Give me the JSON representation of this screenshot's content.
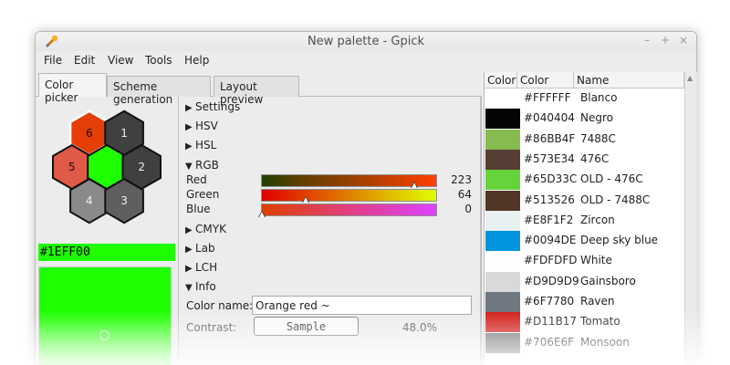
{
  "window": {
    "title": "New palette - Gpick",
    "controls": [
      "–",
      "+",
      "×"
    ]
  },
  "menu": [
    "File",
    "Edit",
    "View",
    "Tools",
    "Help"
  ],
  "tabs": [
    "Color picker",
    "Scheme generation",
    "Layout preview"
  ],
  "hexagons": [
    {
      "label": "6",
      "color": "#e53e07"
    },
    {
      "label": "1",
      "color": "#404040"
    },
    {
      "label": "5",
      "color": "#e05a47"
    },
    {
      "label": "",
      "color": "#1eff00"
    },
    {
      "label": "2",
      "color": "#404040"
    },
    {
      "label": "4",
      "color": "#8a8a8a"
    },
    {
      "label": "3",
      "color": "#5f5f5f"
    }
  ],
  "current_hex": "#1EFF00",
  "expanders": {
    "settings": "Settings",
    "hsv": "HSV",
    "hsl": "HSL",
    "rgb": "RGB",
    "cmyk": "CMYK",
    "lab": "Lab",
    "lch": "LCH",
    "info": "Info"
  },
  "rgb": {
    "red": {
      "label": "Red",
      "value": "223",
      "level": 0.875
    },
    "green": {
      "label": "Green",
      "value": "64",
      "level": 0.25
    },
    "blue": {
      "label": "Blue",
      "value": "0",
      "level": 0.0
    }
  },
  "info": {
    "color_name_label": "Color name:",
    "color_name_value": "Orange red ~",
    "contrast_label": "Contrast:",
    "sample_label": "Sample",
    "contrast_value": "48.0%"
  },
  "palette": {
    "headers": [
      "Color",
      "Color",
      "Name"
    ],
    "rows": [
      {
        "hex": "#FFFFFF",
        "name": "Blanco",
        "color": "#ffffff"
      },
      {
        "hex": "#040404",
        "name": "Negro",
        "color": "#040404"
      },
      {
        "hex": "#86BB4F",
        "name": "7488C",
        "color": "#86bb4f"
      },
      {
        "hex": "#573E34",
        "name": "476C",
        "color": "#573e34"
      },
      {
        "hex": "#65D33C",
        "name": "OLD - 476C",
        "color": "#65d33c"
      },
      {
        "hex": "#513526",
        "name": "OLD - 7488C",
        "color": "#513526"
      },
      {
        "hex": "#E8F1F2",
        "name": "Zircon",
        "color": "#e8f1f2"
      },
      {
        "hex": "#0094DE",
        "name": "Deep sky blue",
        "color": "#0094de"
      },
      {
        "hex": "#FDFDFD",
        "name": "White",
        "color": "#fdfdfd"
      },
      {
        "hex": "#D9D9D9",
        "name": "Gainsboro",
        "color": "#d9d9d9"
      },
      {
        "hex": "#6F7780",
        "name": "Raven",
        "color": "#6f7780"
      },
      {
        "hex": "#D11B17",
        "name": "Tomato",
        "color": "#d11b17"
      },
      {
        "hex": "#706E6F",
        "name": "Monsoon",
        "color": "#706e6f"
      }
    ]
  }
}
